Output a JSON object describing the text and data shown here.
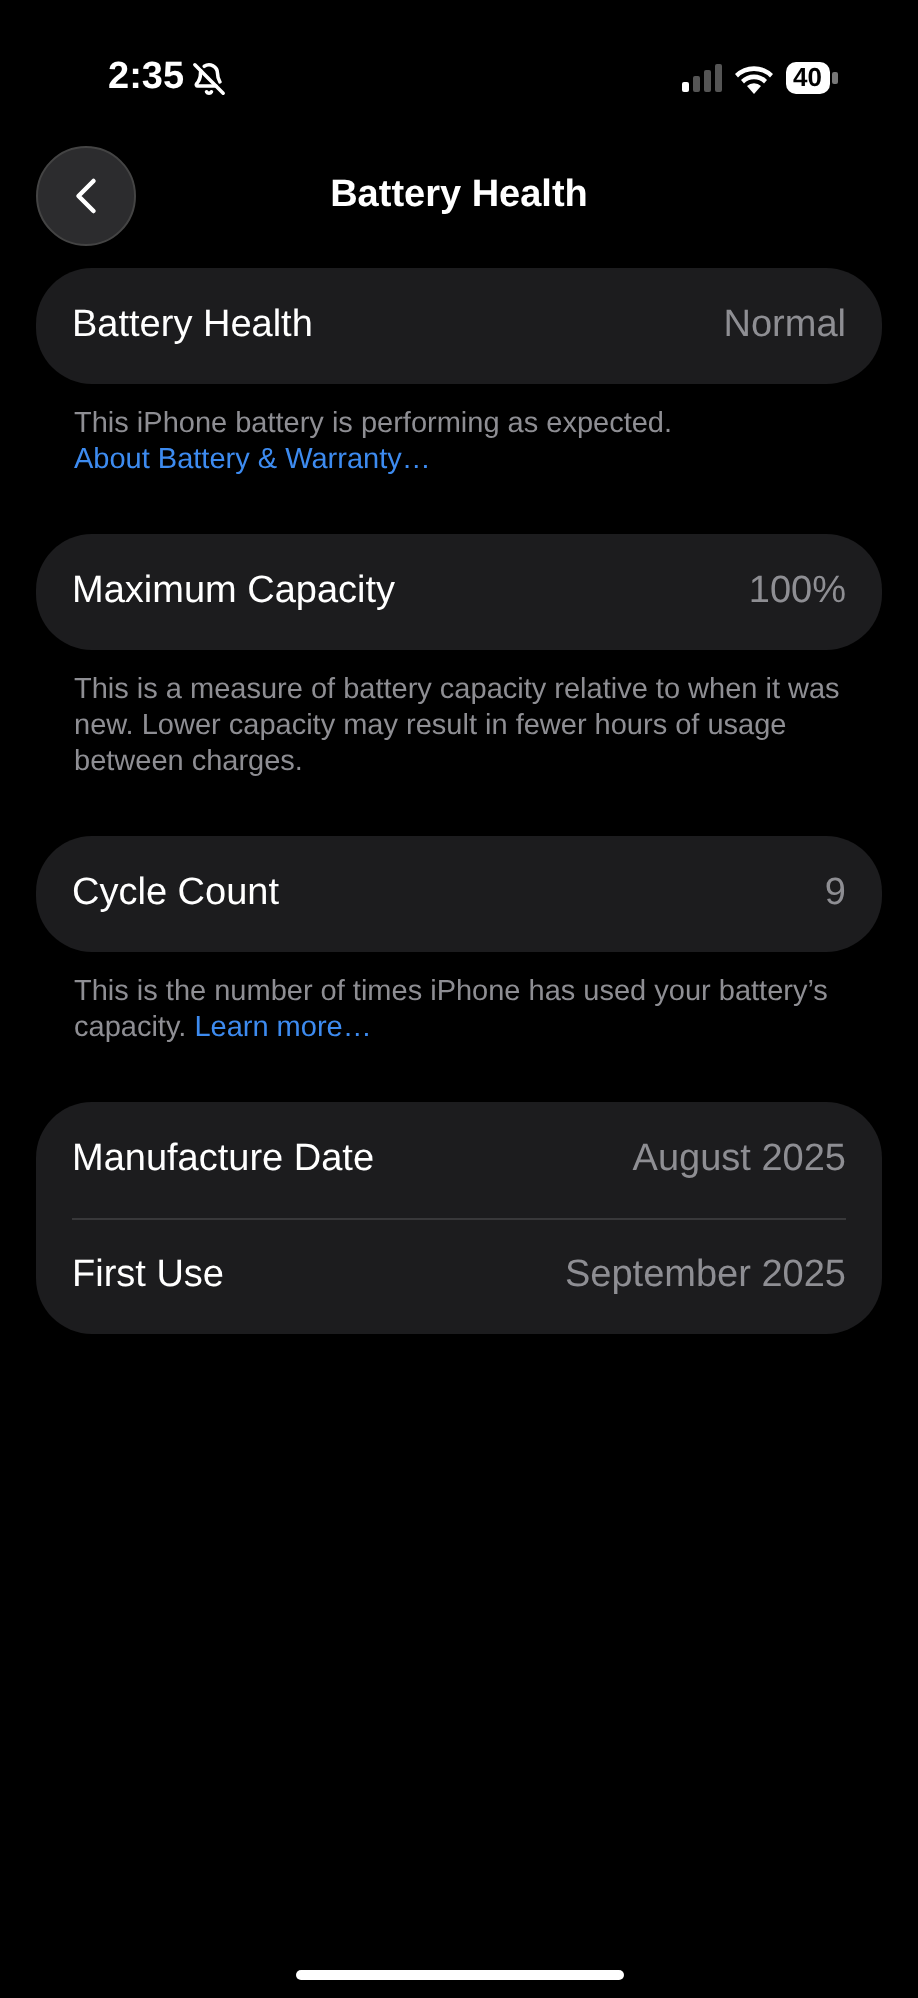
{
  "status_bar": {
    "time": "2:35",
    "battery": "40"
  },
  "header": {
    "title": "Battery Health"
  },
  "sections": [
    {
      "rows": [
        {
          "label": "Battery Health",
          "value": "Normal"
        }
      ],
      "footer": "This iPhone battery is performing as expected.",
      "link": "About Battery & Warranty…"
    },
    {
      "rows": [
        {
          "label": "Maximum Capacity",
          "value": "100%"
        }
      ],
      "footer": "This is a measure of battery capacity relative to when it was new. Lower capacity may result in fewer hours of usage between charges."
    },
    {
      "rows": [
        {
          "label": "Cycle Count",
          "value": "9"
        }
      ],
      "footer": "This is the number of times iPhone has used your battery’s capacity.",
      "link": "Learn more…"
    },
    {
      "rows": [
        {
          "label": "Manufacture Date",
          "value": "August 2025"
        },
        {
          "label": "First Use",
          "value": "September 2025"
        }
      ]
    }
  ]
}
